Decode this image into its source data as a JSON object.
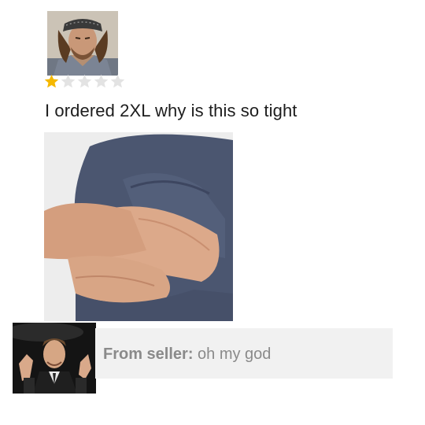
{
  "review": {
    "rating": 1,
    "max_rating": 5,
    "text": "I ordered 2XL why is this so tight"
  },
  "icons": {
    "star_filled": "star-filled-icon",
    "star_empty": "star-empty-icon"
  },
  "colors": {
    "star_filled": "#f5b800",
    "star_empty": "#e3e3e3",
    "shirt": "#4b5670",
    "reply_bg": "#f1f1f1",
    "reply_text": "#8a8a8a"
  },
  "seller_reply": {
    "label": "From seller:",
    "text": " oh my god"
  }
}
